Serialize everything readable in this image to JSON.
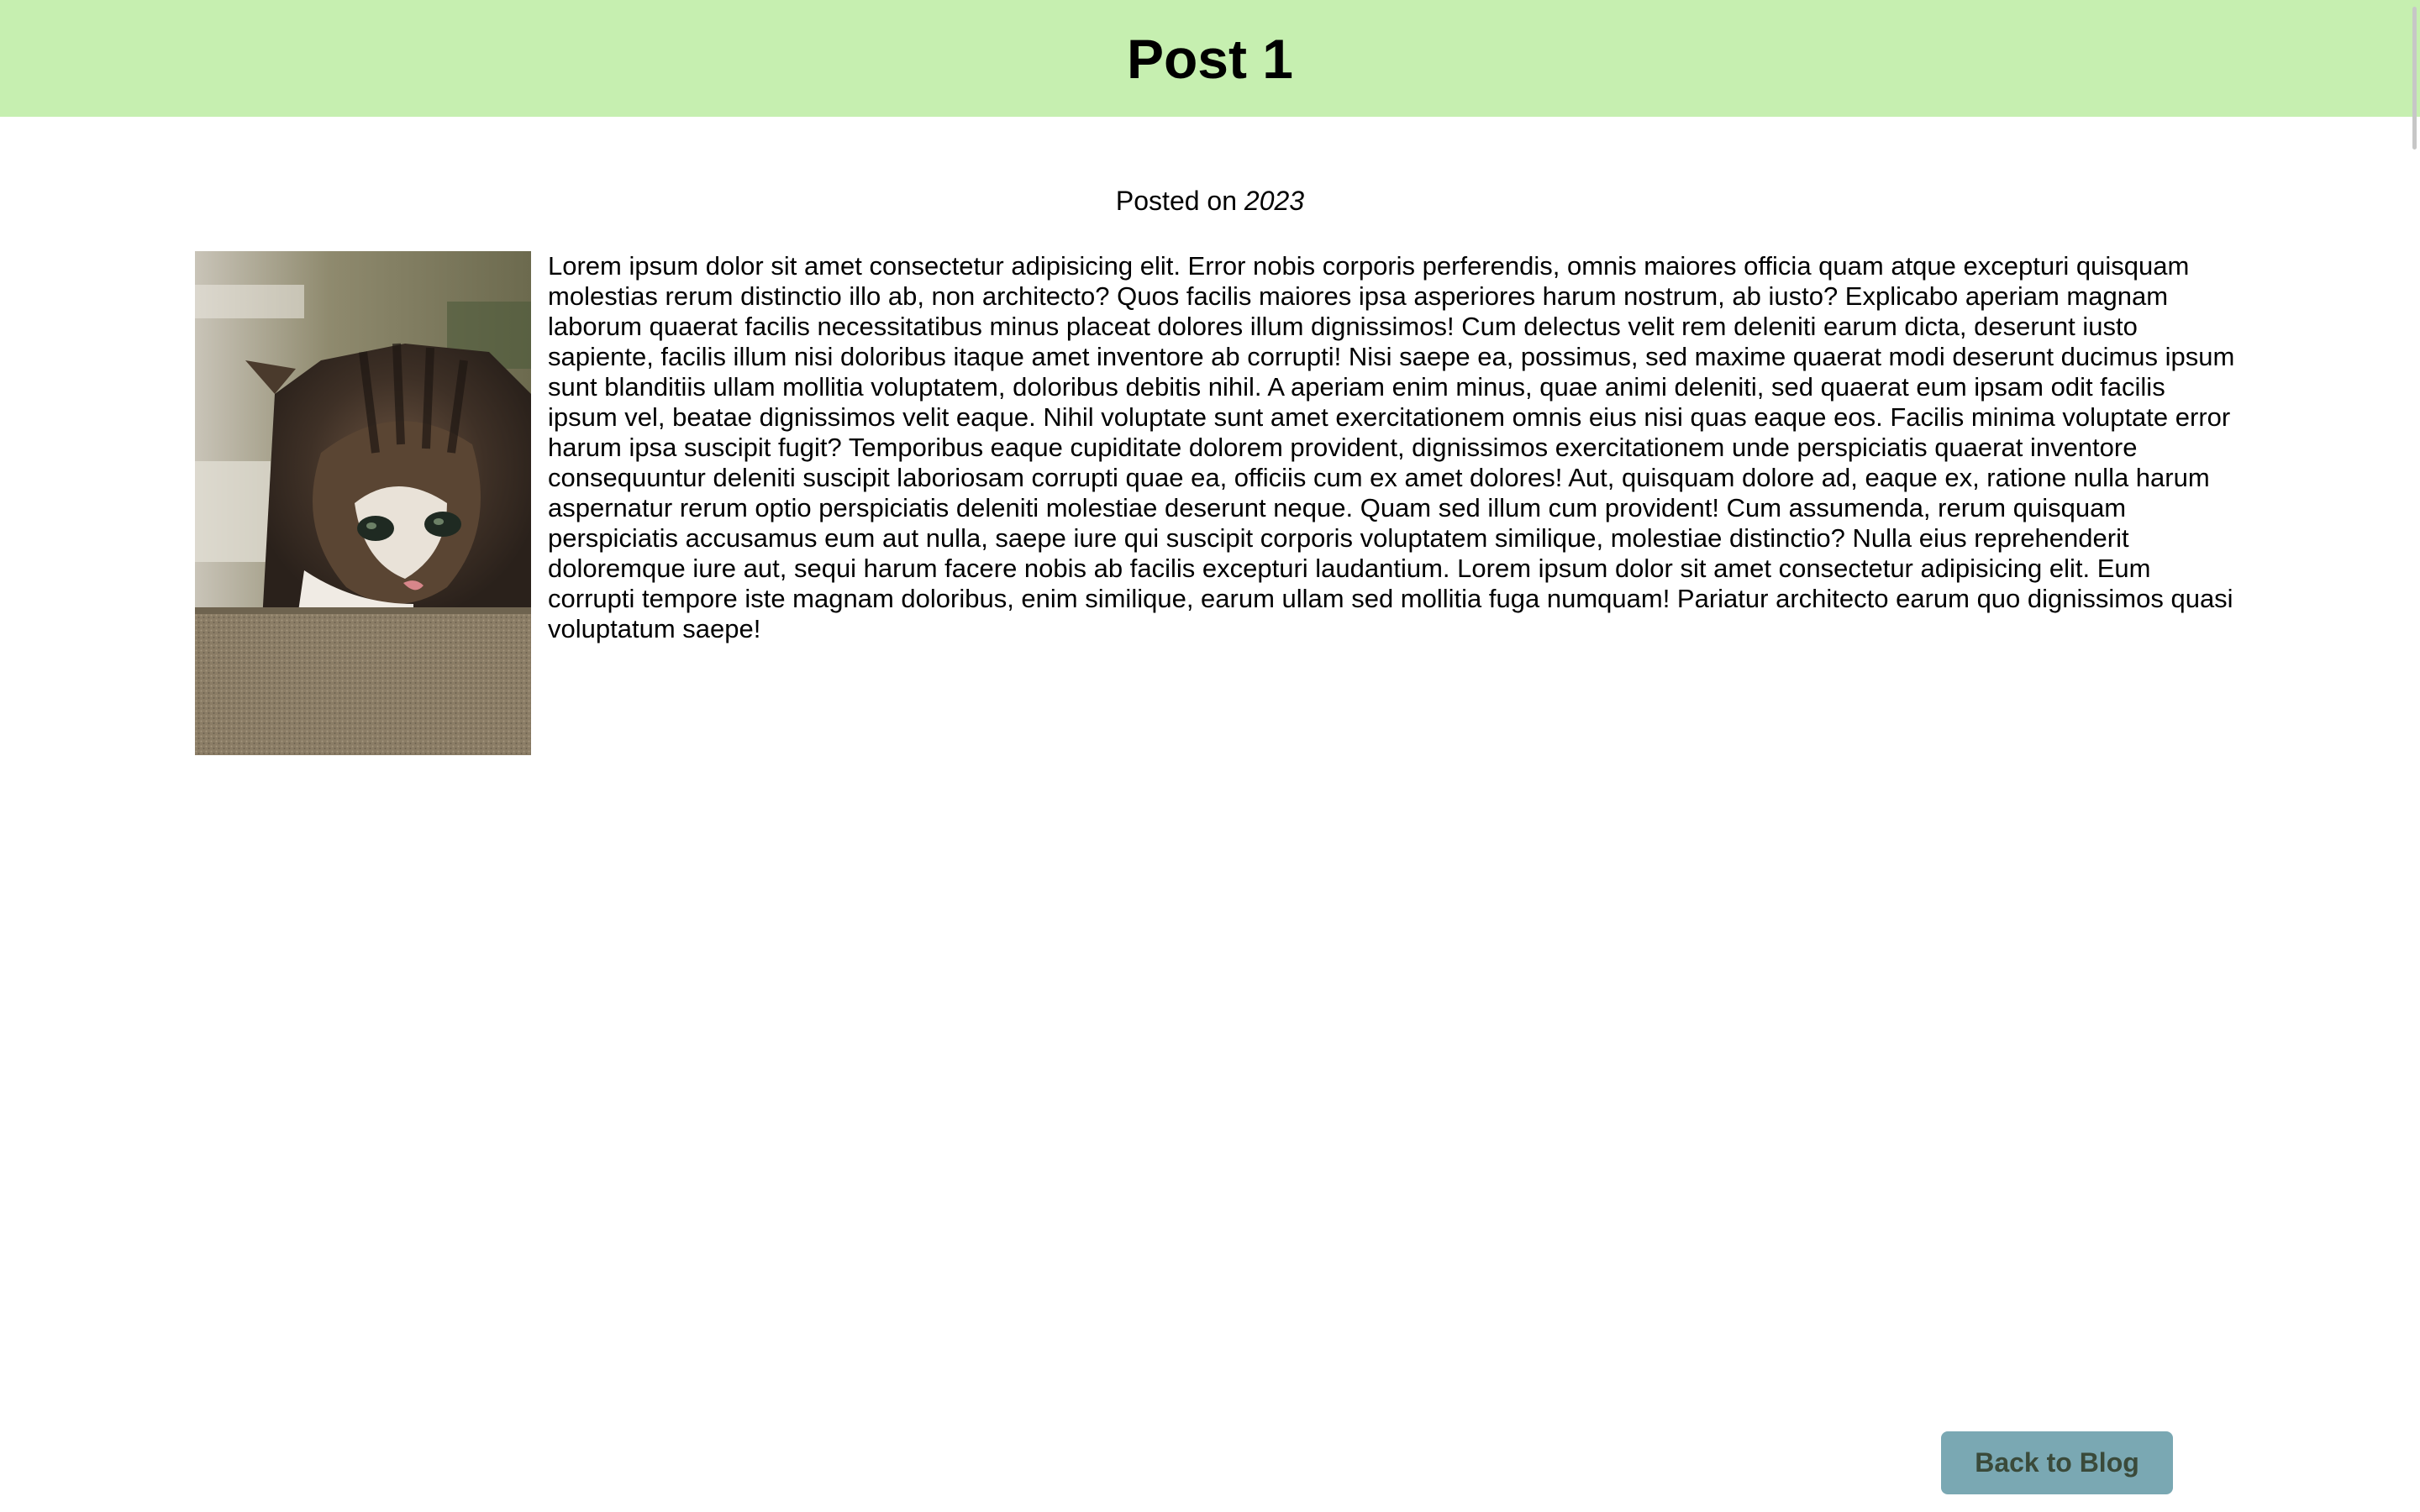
{
  "header": {
    "title": "Post 1",
    "background_color": "#c6efb0"
  },
  "meta": {
    "posted_label": "Posted on",
    "year": "2023"
  },
  "post": {
    "image_icon": "kitten-photo",
    "body": "Lorem ipsum dolor sit amet consectetur adipisicing elit. Error nobis corporis perferendis, omnis maiores officia quam atque excepturi quisquam molestias rerum distinctio illo ab, non architecto? Quos facilis maiores ipsa asperiores harum nostrum, ab iusto? Explicabo aperiam magnam laborum quaerat facilis necessitatibus minus placeat dolores illum dignissimos! Cum delectus velit rem deleniti earum dicta, deserunt iusto sapiente, facilis illum nisi doloribus itaque amet inventore ab corrupti! Nisi saepe ea, possimus, sed maxime quaerat modi deserunt ducimus ipsum sunt blanditiis ullam mollitia voluptatem, doloribus debitis nihil. A aperiam enim minus, quae animi deleniti, sed quaerat eum ipsam odit facilis ipsum vel, beatae dignissimos velit eaque. Nihil voluptate sunt amet exercitationem omnis eius nisi quas eaque eos. Facilis minima voluptate error harum ipsa suscipit fugit? Temporibus eaque cupiditate dolorem provident, dignissimos exercitationem unde perspiciatis quaerat inventore consequuntur deleniti suscipit laboriosam corrupti quae ea, officiis cum ex amet dolores! Aut, quisquam dolore ad, eaque ex, ratione nulla harum aspernatur rerum optio perspiciatis deleniti molestiae deserunt neque. Quam sed illum cum provident! Cum assumenda, rerum quisquam perspiciatis accusamus eum aut nulla, saepe iure qui suscipit corporis voluptatem similique, molestiae distinctio? Nulla eius reprehenderit doloremque iure aut, sequi harum facere nobis ab facilis excepturi laudantium. Lorem ipsum dolor sit amet consectetur adipisicing elit. Eum corrupti tempore iste magnam doloribus, enim similique, earum ullam sed mollitia fuga numquam! Pariatur architecto earum quo dignissimos quasi voluptatum saepe!"
  },
  "actions": {
    "back_label": "Back to Blog",
    "back_color": "#7aa8b3"
  }
}
